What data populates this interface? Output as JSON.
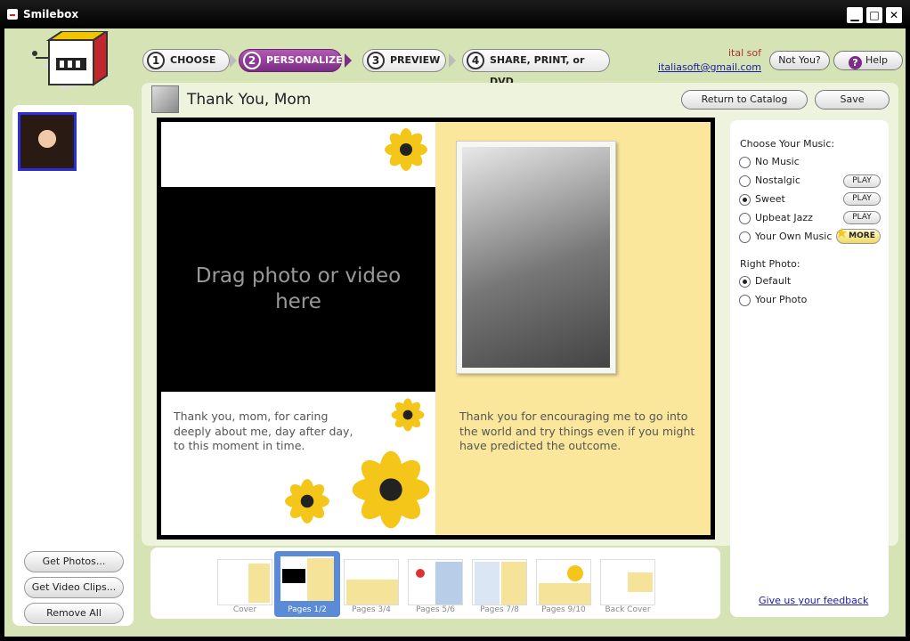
{
  "window": {
    "title": "Smilebox"
  },
  "steps": [
    {
      "num": "1",
      "label": "CHOOSE"
    },
    {
      "num": "2",
      "label": "PERSONALIZE"
    },
    {
      "num": "3",
      "label": "PREVIEW"
    },
    {
      "num": "4",
      "label": "SHARE, PRINT, or DVD"
    }
  ],
  "user": {
    "name": "ital sof",
    "email": "italiasoft@gmail.com"
  },
  "header_buttons": {
    "not_you": "Not You?",
    "help": "Help"
  },
  "project": {
    "title": "Thank You, Mom"
  },
  "actions": {
    "return": "Return to Catalog",
    "save": "Save"
  },
  "left_buttons": {
    "get_photos": "Get Photos...",
    "get_video": "Get Video Clips...",
    "remove_all": "Remove All"
  },
  "canvas": {
    "drop_text_1": "Drag photo or video",
    "drop_text_2": "here",
    "left_text": "Thank you, mom, for caring deeply about me, day after day, to this moment in time.",
    "right_text": "Thank you for encouraging me to go into the world and try things even if you might have predicted the outcome."
  },
  "music": {
    "heading": "Choose Your Music:",
    "options": [
      "No Music",
      "Nostalgic",
      "Sweet",
      "Upbeat Jazz",
      "Your Own Music"
    ],
    "selected": "Sweet",
    "play_label": "PLAY",
    "more_label": "MORE"
  },
  "right_photo": {
    "heading": "Right Photo:",
    "options": [
      "Default",
      "Your Photo"
    ],
    "selected": "Default"
  },
  "feedback": "Give us your feedback",
  "pages": [
    "Cover",
    "Pages 1/2",
    "Pages 3/4",
    "Pages 5/6",
    "Pages 7/8",
    "Pages 9/10",
    "Back Cover"
  ],
  "selected_page": "Pages 1/2",
  "colors": {
    "accent": "#7a2c86",
    "frame": "#d6e3b5",
    "page_yellow": "#fbe79b",
    "flower": "#f4c61a"
  }
}
